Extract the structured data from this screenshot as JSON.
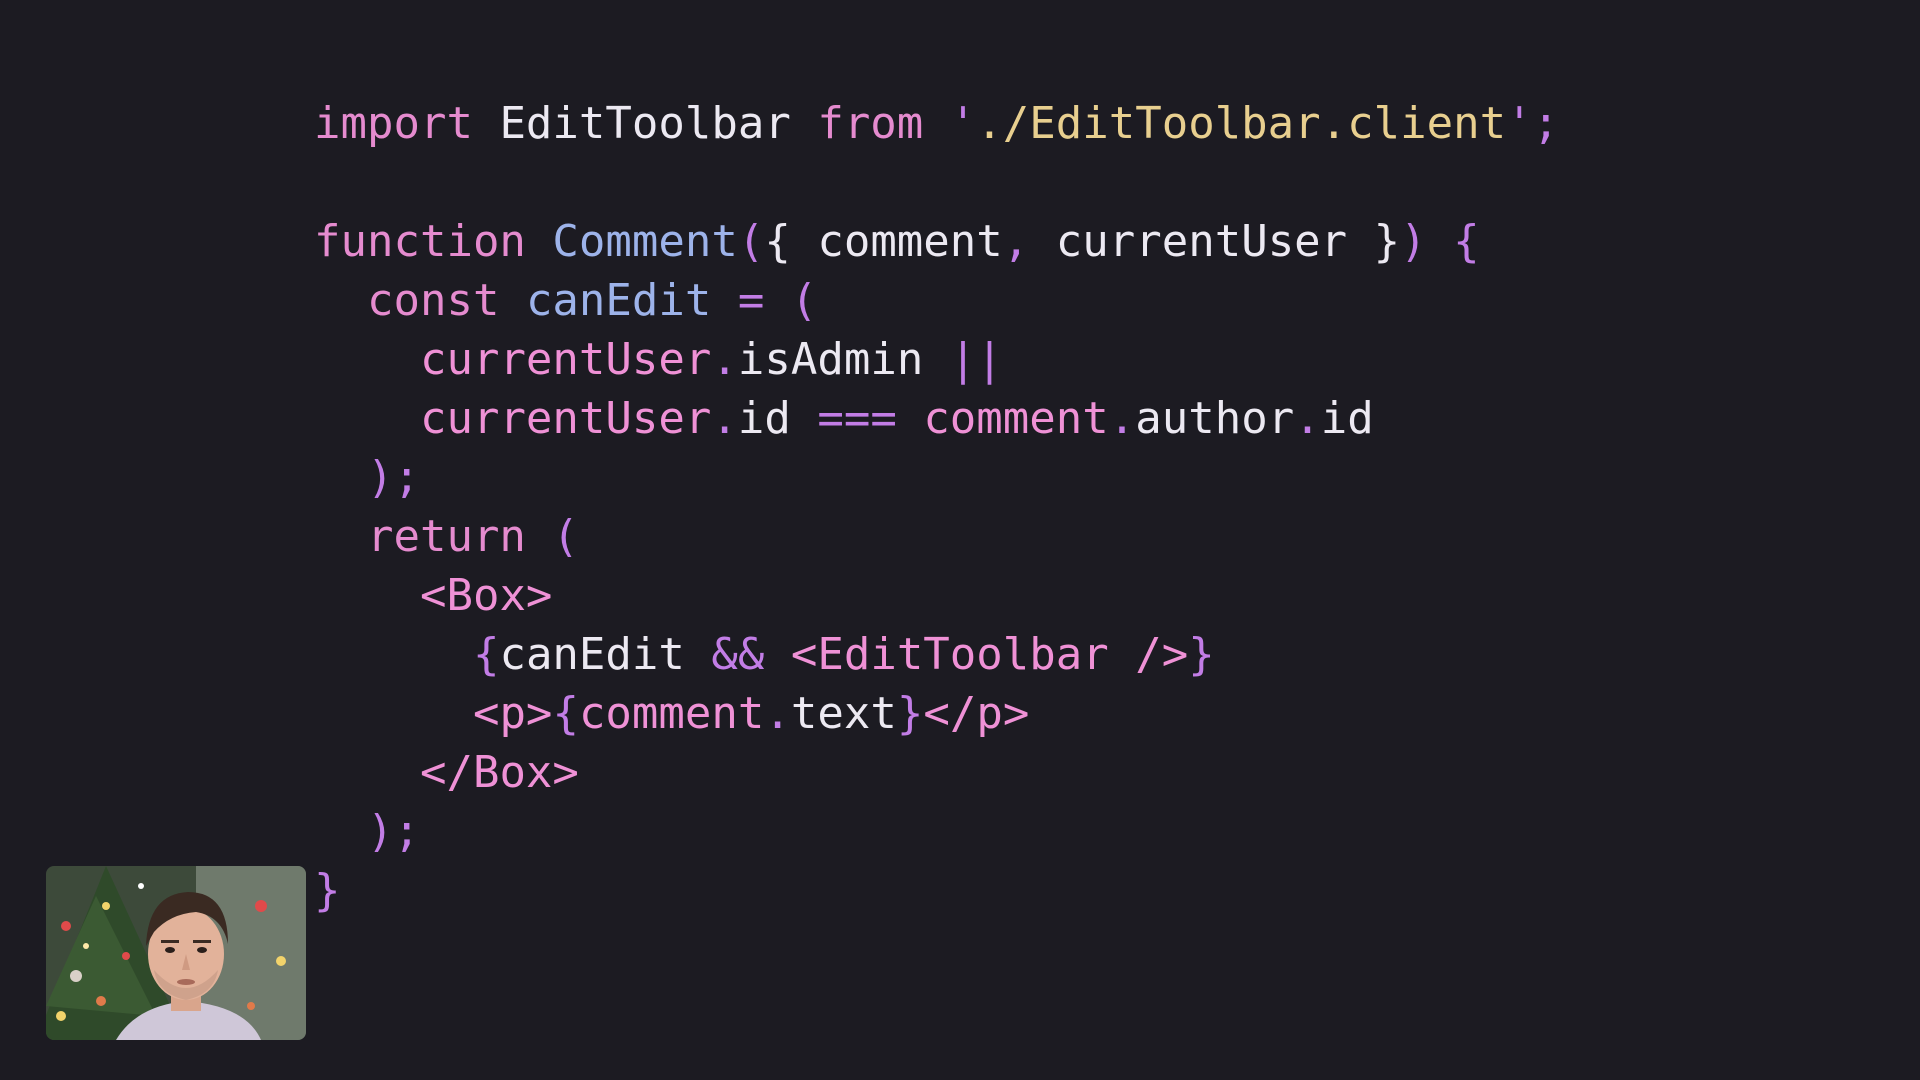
{
  "code": {
    "language": "jsx",
    "lines": [
      [
        {
          "text": "import",
          "kind": "kw"
        },
        {
          "text": " EditToolbar ",
          "kind": "id"
        },
        {
          "text": "from",
          "kind": "kw"
        },
        {
          "text": " '",
          "kind": "punc"
        },
        {
          "text": "./EditToolbar.client",
          "kind": "str"
        },
        {
          "text": "';",
          "kind": "punc"
        }
      ],
      [],
      [
        {
          "text": "function",
          "kind": "kw"
        },
        {
          "text": " ",
          "kind": "id"
        },
        {
          "text": "Comment",
          "kind": "fn"
        },
        {
          "text": "(",
          "kind": "punc"
        },
        {
          "text": "{ comment",
          "kind": "id"
        },
        {
          "text": ",",
          "kind": "punc"
        },
        {
          "text": " currentUser }",
          "kind": "id"
        },
        {
          "text": ")",
          "kind": "punc"
        },
        {
          "text": " ",
          "kind": "id"
        },
        {
          "text": "{",
          "kind": "punc"
        }
      ],
      [
        {
          "text": "  ",
          "kind": "id"
        },
        {
          "text": "const",
          "kind": "kw"
        },
        {
          "text": " ",
          "kind": "id"
        },
        {
          "text": "canEdit",
          "kind": "fn"
        },
        {
          "text": " = (",
          "kind": "op"
        }
      ],
      [
        {
          "text": "    ",
          "kind": "id"
        },
        {
          "text": "currentUser",
          "kind": "var"
        },
        {
          "text": ".",
          "kind": "punc"
        },
        {
          "text": "isAdmin",
          "kind": "id"
        },
        {
          "text": " ||",
          "kind": "op"
        }
      ],
      [
        {
          "text": "    ",
          "kind": "id"
        },
        {
          "text": "currentUser",
          "kind": "var"
        },
        {
          "text": ".",
          "kind": "punc"
        },
        {
          "text": "id",
          "kind": "id"
        },
        {
          "text": " === ",
          "kind": "op"
        },
        {
          "text": "comment",
          "kind": "var"
        },
        {
          "text": ".",
          "kind": "punc"
        },
        {
          "text": "author",
          "kind": "id"
        },
        {
          "text": ".",
          "kind": "punc"
        },
        {
          "text": "id",
          "kind": "id"
        }
      ],
      [
        {
          "text": "  ",
          "kind": "id"
        },
        {
          "text": ");",
          "kind": "punc"
        }
      ],
      [
        {
          "text": "  ",
          "kind": "id"
        },
        {
          "text": "return",
          "kind": "kw"
        },
        {
          "text": " (",
          "kind": "punc"
        }
      ],
      [
        {
          "text": "    ",
          "kind": "id"
        },
        {
          "text": "<Box>",
          "kind": "var"
        }
      ],
      [
        {
          "text": "      ",
          "kind": "id"
        },
        {
          "text": "{",
          "kind": "punc"
        },
        {
          "text": "canEdit",
          "kind": "id"
        },
        {
          "text": " && ",
          "kind": "op"
        },
        {
          "text": "<EditToolbar />",
          "kind": "var"
        },
        {
          "text": "}",
          "kind": "punc"
        }
      ],
      [
        {
          "text": "      ",
          "kind": "id"
        },
        {
          "text": "<p>",
          "kind": "var"
        },
        {
          "text": "{",
          "kind": "punc"
        },
        {
          "text": "comment",
          "kind": "var"
        },
        {
          "text": ".",
          "kind": "punc"
        },
        {
          "text": "text",
          "kind": "id"
        },
        {
          "text": "}",
          "kind": "punc"
        },
        {
          "text": "</p>",
          "kind": "var"
        }
      ],
      [
        {
          "text": "    ",
          "kind": "id"
        },
        {
          "text": "</Box>",
          "kind": "var"
        }
      ],
      [
        {
          "text": "  ",
          "kind": "id"
        },
        {
          "text": ");",
          "kind": "punc"
        }
      ],
      [
        {
          "text": "}",
          "kind": "punc"
        }
      ]
    ]
  },
  "webcam": {
    "description_icon": "presenter-webcam-icon"
  },
  "colors": {
    "background": "#1c1b22",
    "keyword": "#e58bcf",
    "identifier": "#ece9f2",
    "string": "#e8cf8f",
    "function": "#9db3ea",
    "punctuation": "#c27de6",
    "variable": "#ef91d6"
  }
}
